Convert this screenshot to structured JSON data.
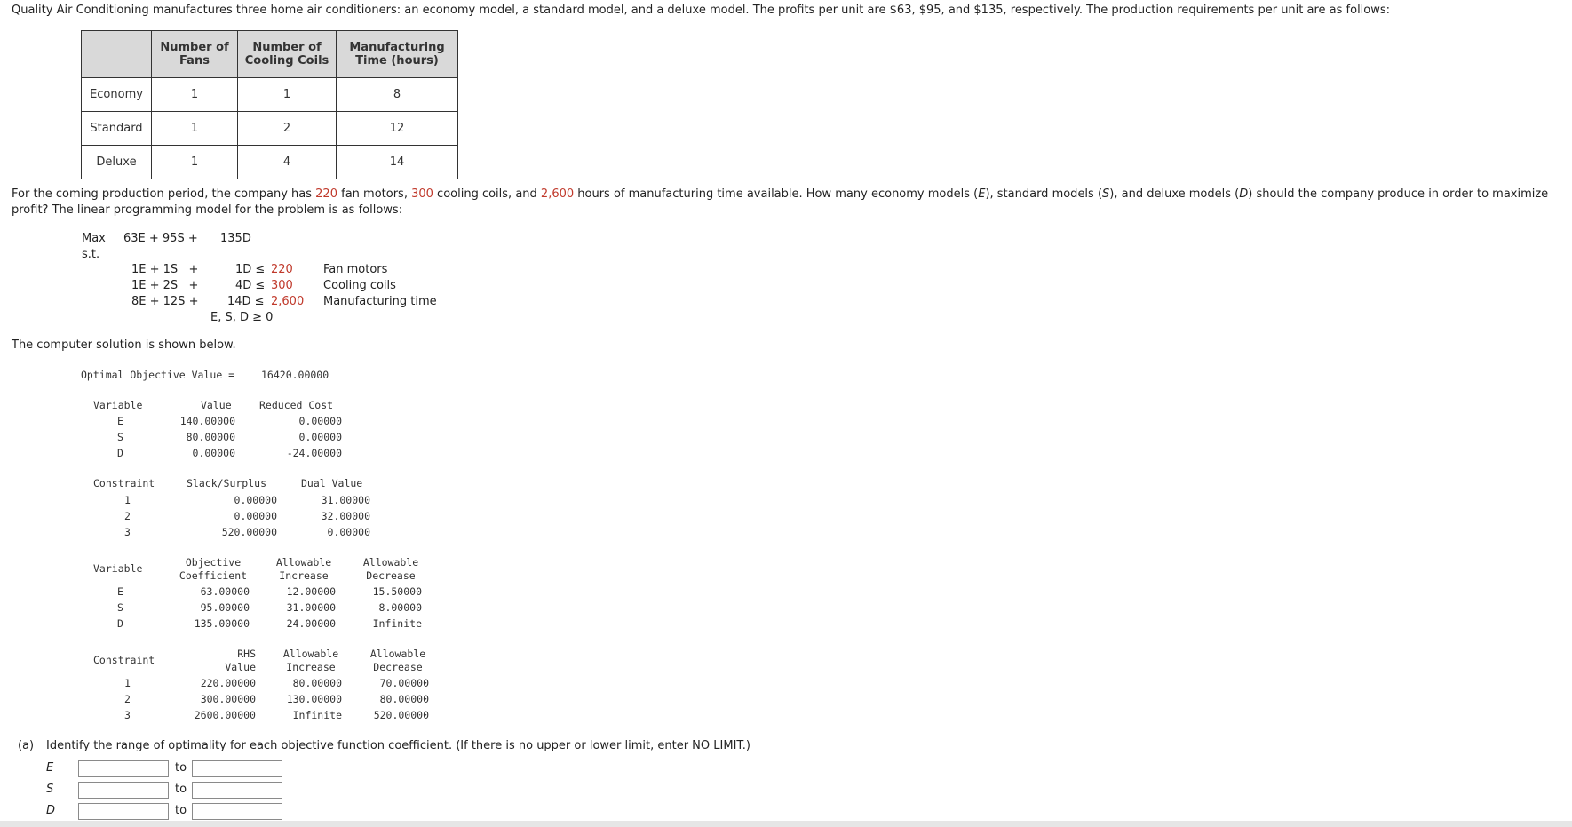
{
  "intro": {
    "p1_a": "Quality Air Conditioning manufactures three home air conditioners: an economy model, a standard model, and a deluxe model. The profits per unit are $63, $95, and $135, respectively. The production requirements per unit are as follows:"
  },
  "req_table": {
    "headers": [
      "Number of\nFans",
      "Number of\nCooling Coils",
      "Manufacturing\nTime (hours)"
    ],
    "rows": [
      {
        "label": "Economy",
        "values": [
          "1",
          "1",
          "8"
        ]
      },
      {
        "label": "Standard",
        "values": [
          "1",
          "2",
          "12"
        ]
      },
      {
        "label": "Deluxe",
        "values": [
          "1",
          "4",
          "14"
        ]
      }
    ]
  },
  "p2": {
    "a": "For the coming production period, the company has ",
    "fans": "220",
    "b": " fan motors, ",
    "coils": "300",
    "c": " cooling coils, and ",
    "hours": "2,600",
    "d": " hours of manufacturing time available. How many economy models (",
    "e": "E",
    "f": "), standard models (",
    "s": "S",
    "g": "), and deluxe models (",
    "dvar": "D",
    "h": ") should the company produce in order to maximize",
    "line2": "profit? The linear programming model for the problem is as follows:"
  },
  "model": {
    "max": "Max",
    "objective": "63E + 95S +",
    "objective_d": "135D",
    "st": "s.t.",
    "c1_left": "1E + 1S   +",
    "c1_mid": "1D ≤",
    "c1_rhs": "220",
    "c1_name": "Fan motors",
    "c2_left": "1E + 2S   +",
    "c2_mid": "4D ≤",
    "c2_rhs": "300",
    "c2_name": "Cooling coils",
    "c3_left": "8E + 12S +",
    "c3_mid": "14D ≤",
    "c3_rhs": "2,600",
    "c3_name": "Manufacturing time",
    "nonneg": "E, S, D ≥ 0"
  },
  "solution_intro": "The computer solution is shown below.",
  "solution": {
    "objective_label": "Optimal Objective Value =",
    "objective_value": "16420.00000",
    "var_headers": [
      "Variable",
      "Value",
      "Reduced Cost"
    ],
    "vars": [
      {
        "name": "E",
        "value": "140.00000",
        "reduced": "0.00000"
      },
      {
        "name": "S",
        "value": "80.00000",
        "reduced": "0.00000"
      },
      {
        "name": "D",
        "value": "0.00000",
        "reduced": "-24.00000"
      }
    ],
    "con_headers": [
      "Constraint",
      "Slack/Surplus",
      "Dual Value"
    ],
    "cons": [
      {
        "name": "1",
        "slack": "0.00000",
        "dual": "31.00000"
      },
      {
        "name": "2",
        "slack": "0.00000",
        "dual": "32.00000"
      },
      {
        "name": "3",
        "slack": "520.00000",
        "dual": "0.00000"
      }
    ],
    "range_headers": [
      "Variable",
      "Objective\nCoefficient",
      "Allowable\nIncrease",
      "Allowable\nDecrease"
    ],
    "ranges": [
      {
        "name": "E",
        "coef": "63.00000",
        "inc": "12.00000",
        "dec": "15.50000"
      },
      {
        "name": "S",
        "coef": "95.00000",
        "inc": "31.00000",
        "dec": "8.00000"
      },
      {
        "name": "D",
        "coef": "135.00000",
        "inc": "24.00000",
        "dec": "Infinite"
      }
    ],
    "rhs_headers": [
      "Constraint",
      "RHS\nValue",
      "Allowable\nIncrease",
      "Allowable\nDecrease"
    ],
    "rhs": [
      {
        "name": "1",
        "value": "220.00000",
        "inc": "80.00000",
        "dec": "70.00000"
      },
      {
        "name": "2",
        "value": "300.00000",
        "inc": "130.00000",
        "dec": "80.00000"
      },
      {
        "name": "3",
        "value": "2600.00000",
        "inc": "Infinite",
        "dec": "520.00000"
      }
    ]
  },
  "question_a": {
    "label": "(a)",
    "text": "Identify the range of optimality for each objective function coefficient. (If there is no upper or lower limit, enter NO LIMIT.)",
    "rows": [
      {
        "var": "E",
        "to": "to",
        "low": "",
        "high": ""
      },
      {
        "var": "S",
        "to": "to",
        "low": "",
        "high": ""
      },
      {
        "var": "D",
        "to": "to",
        "low": "",
        "high": ""
      }
    ]
  }
}
